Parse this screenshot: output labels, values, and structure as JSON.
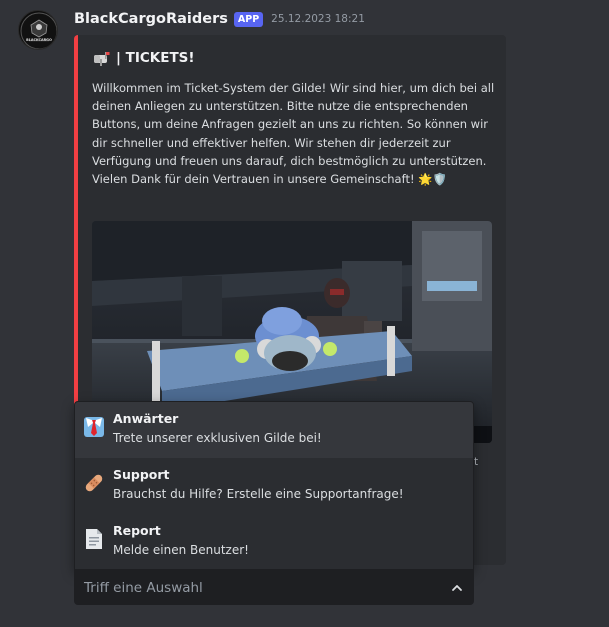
{
  "message": {
    "username": "BlackCargoRaiders",
    "app_badge": "APP",
    "timestamp": "25.12.2023 18:21",
    "avatar_text": "BLACKCARGO"
  },
  "embed": {
    "accent_color": "#f23f43",
    "title_icon": "mailbox-icon",
    "title": "| TICKETS!",
    "description": "Willkommen im Ticket-System der Gilde! Wir sind hier, um dich bei all deinen Anliegen zu unterstützen. Bitte nutze die entsprechenden Buttons, um deine Anfragen gezielt an uns zu richten. So können wir dir schneller und effektiver helfen. Wir stehen dir jederzeit zur Verfügung und freuen uns darauf, dich bestmöglich zu unterstützen. Vielen Dank für dein Vertrauen in unsere Gemeinschaft! 🌟🛡️",
    "footer_fragment": "t"
  },
  "dropdown": {
    "options": [
      {
        "icon": "necktie-icon",
        "label": "Anwärter",
        "description": "Trete unserer exklusiven Gilde bei!"
      },
      {
        "icon": "bandage-icon",
        "label": "Support",
        "description": "Brauchst du Hilfe? Erstelle eine Supportanfrage!"
      },
      {
        "icon": "document-icon",
        "label": "Report",
        "description": "Melde einen Benutzer!"
      }
    ],
    "placeholder": "Triff eine Auswahl",
    "toggle_icon": "chevron-up-icon"
  },
  "colors": {
    "background": "#313338",
    "embed_bg": "#2b2d31",
    "app_badge": "#5865f2",
    "select_bg": "#1e1f22"
  }
}
